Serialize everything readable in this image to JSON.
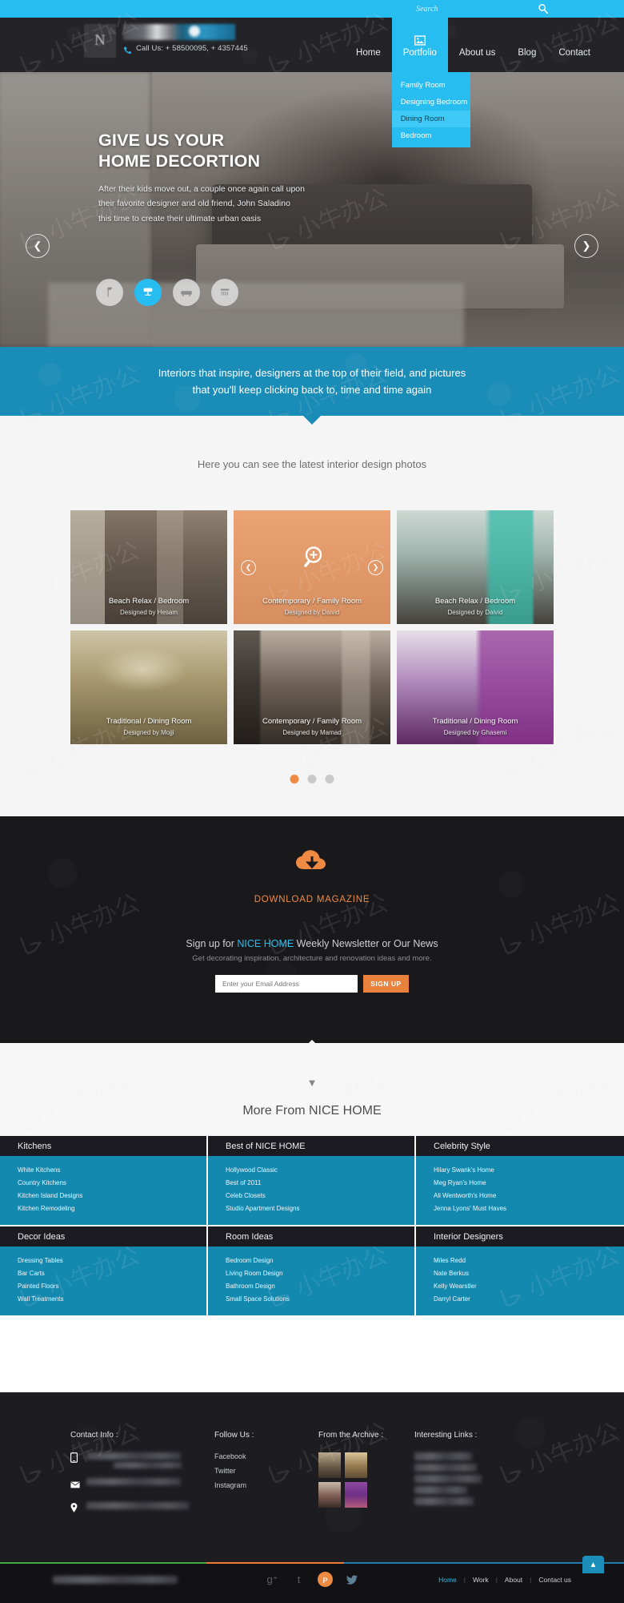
{
  "search": {
    "placeholder": "Search",
    "icon": "search-icon"
  },
  "brand": {
    "logo_letter": "N",
    "phone": "Call Us: + 58500095, + 4357445",
    "phone_icon": "phone-icon"
  },
  "nav": {
    "items": [
      {
        "label": "Home",
        "active": false
      },
      {
        "label": "Portfolio",
        "active": true,
        "icon": "image-icon"
      },
      {
        "label": "About us",
        "active": false
      },
      {
        "label": "Blog",
        "active": false
      },
      {
        "label": "Contact",
        "active": false
      }
    ],
    "dropdown": [
      {
        "label": "Family Room",
        "highlighted": false
      },
      {
        "label": "Designing Bedroom",
        "highlighted": false
      },
      {
        "label": "Dining Room",
        "highlighted": true
      },
      {
        "label": "Bedroom",
        "highlighted": false
      }
    ]
  },
  "hero": {
    "heading_line1": "GIVE US YOUR",
    "heading_line2": "HOME DECORTION",
    "paragraph_line1": "After their kids move out, a couple once again call upon",
    "paragraph_line2": "their favorite designer and old friend, John Saladino",
    "paragraph_line3": "this time to create their ultimate urban oasis",
    "feature_icons": [
      {
        "name": "lamp-icon",
        "active": false
      },
      {
        "name": "chair-icon",
        "active": true
      },
      {
        "name": "sofa-icon",
        "active": false
      },
      {
        "name": "shower-icon",
        "active": false
      }
    ],
    "prev_arrow": "chevron-left-icon",
    "next_arrow": "chevron-right-icon"
  },
  "band": {
    "line1": "Interiors that inspire, designers at the top of their field, and pictures",
    "line2": "that you'll keep clicking back to, time and time again"
  },
  "gallery": {
    "title": "Here you can see the latest interior design photos",
    "tiles": [
      {
        "title": "Beach Relax / Bedroom",
        "designer": "Designed by Hesam",
        "hovered": false
      },
      {
        "title": "Contemporary / Family Room",
        "designer": "Designed by Daivid",
        "hovered": true
      },
      {
        "title": "Beach Relax / Bedroom",
        "designer": "Designed by Daivid",
        "hovered": false
      },
      {
        "title": "Traditional / Dining Room",
        "designer": "Designed by Mojji",
        "hovered": false
      },
      {
        "title": "Contemporary / Family Room",
        "designer": "Designed by Mamad",
        "hovered": false
      },
      {
        "title": "Traditional / Dining Room",
        "designer": "Designed by Ghasemi",
        "hovered": false
      }
    ],
    "zoom_icon": "magnifier-plus-icon",
    "prev_arrow": "chevron-left-icon",
    "next_arrow": "chevron-right-icon",
    "dots": [
      {
        "active": true
      },
      {
        "active": false
      },
      {
        "active": false
      }
    ]
  },
  "newsletter": {
    "cloud_icon": "cloud-download-icon",
    "download_label": "DOWNLOAD MAGAZINE",
    "signup_pre": "Sign up for ",
    "signup_brand": "NICE HOME",
    "signup_post": " Weekly Newsletter or Our News",
    "subtitle": "Get decorating inspiration, architecture and renovation ideas and more.",
    "email_placeholder": "Enter your Email Address",
    "button_label": "SIGN UP"
  },
  "more": {
    "title": "More From NICE HOME",
    "chevron_icon": "chevron-down-icon",
    "columns": [
      {
        "header": "Kitchens",
        "links": [
          "White Kitchens",
          "Country Kitchens",
          "Kitchen Island Designs",
          "Kitchen Remodeling"
        ]
      },
      {
        "header": "Best of NICE HOME",
        "links": [
          "Hollywood Classic",
          "Best of 2011",
          "Celeb Closets",
          "Studio Apartment Designs"
        ]
      },
      {
        "header": "Celebrity Style",
        "links": [
          "Hilary Swank's Home",
          "Meg Ryan's Home",
          "Ali Wentworth's Home",
          "Jenna Lyons' Must Haves"
        ]
      },
      {
        "header": "Decor Ideas",
        "links": [
          "Dressing Tables",
          "Bar Carts",
          "Painted Floors",
          "Wall Treatments"
        ]
      },
      {
        "header": "Room Ideas",
        "links": [
          "Bedroom Design",
          "Living Room Design",
          "Bathroom Design",
          "Small Space Solutions"
        ]
      },
      {
        "header": "Interior Designers",
        "links": [
          "Miles Redd",
          "Nate Berkus",
          "Kelly Wearstler",
          "Darryl Carter"
        ]
      }
    ]
  },
  "footer": {
    "contact_header": "Contact Info :",
    "contact_rows": [
      {
        "icon": "mobile-icon"
      },
      {
        "icon": "envelope-icon"
      },
      {
        "icon": "map-pin-icon"
      }
    ],
    "follow_header": "Follow Us  :",
    "follow_links": [
      "Facebook",
      "Twitter",
      "Instagram"
    ],
    "archive_header": "From the Archive  :",
    "links_header": "Interesting Links  :"
  },
  "bottom": {
    "social_icons": [
      {
        "name": "google-plus-icon",
        "glyph": "g⁺",
        "highlighted": false
      },
      {
        "name": "tumblr-icon",
        "glyph": "t",
        "highlighted": false
      },
      {
        "name": "pinterest-icon",
        "glyph": "ᴘ",
        "highlighted": true
      },
      {
        "name": "twitter-icon",
        "glyph": "ᵛ",
        "highlighted": false
      }
    ],
    "nav": [
      "Home",
      "Work",
      "About",
      "Contact us"
    ],
    "back_to_top_icon": "chevron-up-icon"
  },
  "colors": {
    "accent_blue": "#27bdf0",
    "band_blue": "#1a8cb8",
    "panel_blue": "#1389b0",
    "orange": "#ef8a42",
    "dark": "#1b1b21"
  }
}
